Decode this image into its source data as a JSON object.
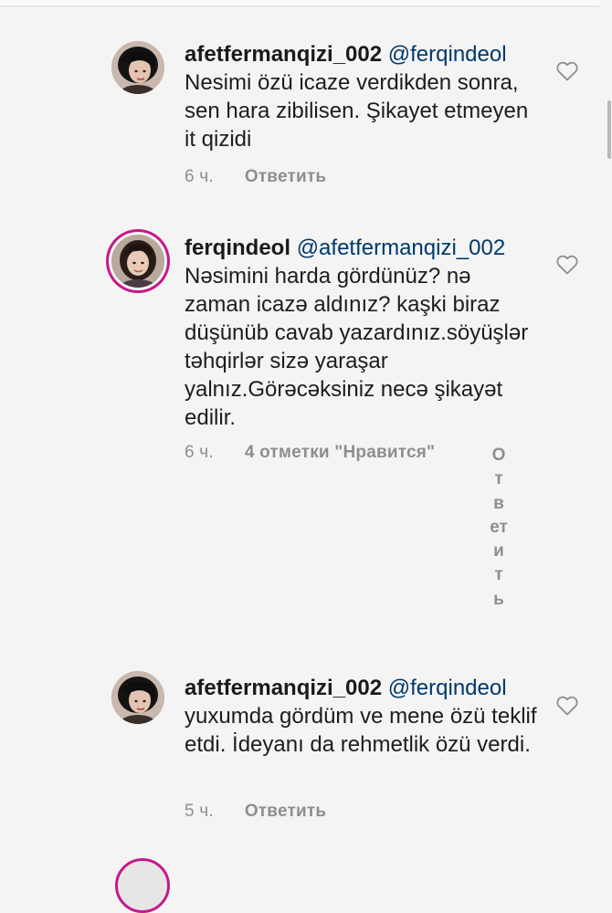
{
  "comments": [
    {
      "username": "afetfermanqizi_002",
      "mention": "@ferqindeol",
      "text": "Nesimi özü icaze verdikden sonra, sen hara zibilisen. Şikayet etmeyen it qizidi",
      "time": "6 ч.",
      "reply_label": "Ответить"
    },
    {
      "username": "ferqindeol",
      "mention": "@afetfermanqizi_002",
      "text": "Nəsimini harda gördünüz? nə zaman icazə aldınız? kaşki biraz düşünüb cavab yazardınız.söyüşlər təhqirlər sizə yaraşar yalnız.Görəcəksiniz necə şikayət edilir.",
      "time": "6 ч.",
      "likes": "4 отметки \"Нравится\"",
      "reply_label": "Ответить"
    },
    {
      "username": "afetfermanqizi_002",
      "mention": "@ferqindeol",
      "text": "yuxumda gördüm ve mene özü teklif etdi. İdeyanı da rehmetlik özü verdi.",
      "time": "5 ч.",
      "reply_label": "Ответить"
    }
  ],
  "colors": {
    "background": "#f4f4f4",
    "mention": "#00376b",
    "meta": "#8e8e8e",
    "story_ring": "#c7178c"
  },
  "icons": [
    "heart-icon",
    "avatar"
  ]
}
